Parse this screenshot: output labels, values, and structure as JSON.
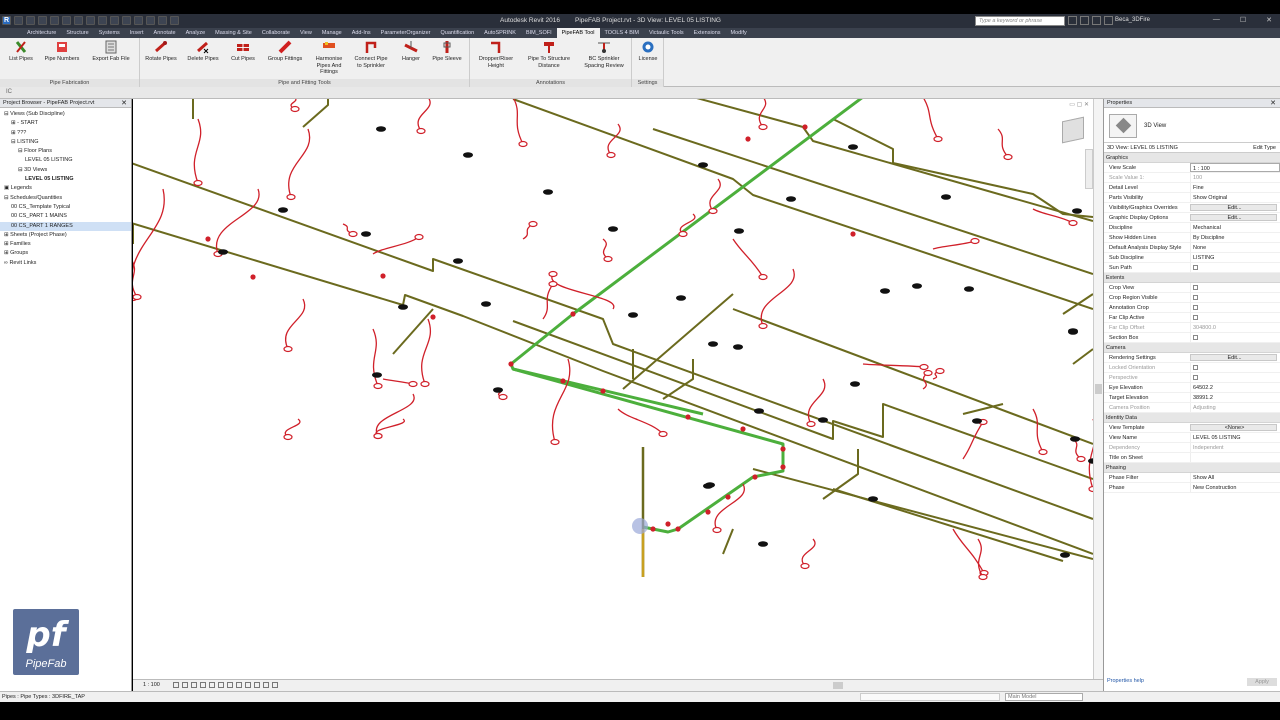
{
  "titlebar": {
    "app": "Autodesk Revit 2016",
    "document": "PipeFAB Project.rvt - 3D View: LEVEL 05 LISTING",
    "search_placeholder": "Type a keyword or phrase",
    "user": "Beca_3DFire"
  },
  "tabs": [
    "Architecture",
    "Structure",
    "Systems",
    "Insert",
    "Annotate",
    "Analyze",
    "Massing & Site",
    "Collaborate",
    "View",
    "Manage",
    "Add-Ins",
    "ParameterOrganizer",
    "Quantification",
    "AutoSPRINK",
    "BIM_SOFI",
    "PipeFAB Tool",
    "TOOLS 4 BIM",
    "Victaulic Tools",
    "Extensions",
    "Modify"
  ],
  "active_tab": "PipeFAB Tool",
  "ribbon": {
    "panels": {
      "pipe_fabrication": "Pipe Fabrication",
      "pipe_fitting_tools": "Pipe and Fitting Tools",
      "annotations": "Annotations",
      "settings": "Settings"
    },
    "buttons": {
      "list_pipes": "List Pipes",
      "pipe_numbers": "Pipe Numbers",
      "export_fab": "Export Fab File",
      "rotate_pipes": "Rotate Pipes",
      "delete_pipes": "Delete Pipes",
      "cut_pipes": "Cut Pipes",
      "group_fittings": "Group Fittings",
      "harmonise": "Harmonise Pipes And Fittings",
      "connect_pipe": "Connect Pipe to Sprinkler",
      "hanger": "Hanger",
      "pipe_sleeve": "Pipe Sleeve",
      "dropper_height": "Dropper/Riser Height",
      "pipe_to_structure": "Pipe To Structure Distance",
      "bc_sprinkler": "BC Sprinkler Spacing Review",
      "license": "License"
    }
  },
  "optionsbar": {
    "label": "IC"
  },
  "browser": {
    "title": "Project Browser - PipeFAB Project.rvt",
    "nodes": [
      {
        "text": "⊟ Views (Sub Discipline)",
        "indent": 0
      },
      {
        "text": "⊞ - START",
        "indent": 1
      },
      {
        "text": "⊞ ???",
        "indent": 1
      },
      {
        "text": "⊟ LISTING",
        "indent": 1
      },
      {
        "text": "⊟ Floor Plans",
        "indent": 2
      },
      {
        "text": "LEVEL 05 LISTING",
        "indent": 3
      },
      {
        "text": "⊟ 3D Views",
        "indent": 2
      },
      {
        "text": "LEVEL 05 LISTING",
        "indent": 3,
        "bold": true
      },
      {
        "text": "▣ Legends",
        "indent": 0
      },
      {
        "text": "⊟ Schedules/Quantities",
        "indent": 0
      },
      {
        "text": "00 CS_Template Typical",
        "indent": 1
      },
      {
        "text": "00 CS_PART 1 MAINS",
        "indent": 1
      },
      {
        "text": "00 CS_PART 1 RANGES",
        "indent": 1,
        "sel": true
      },
      {
        "text": "⊞ Sheets (Project Phase)",
        "indent": 0
      },
      {
        "text": "⊞ Families",
        "indent": 0
      },
      {
        "text": "⊞ Groups",
        "indent": 0
      },
      {
        "text": "∞ Revit Links",
        "indent": 0
      }
    ]
  },
  "logo": {
    "mark": "pf",
    "name": "PipeFab"
  },
  "viewbar": {
    "scale": "1 : 100"
  },
  "properties": {
    "title": "Properties",
    "type_name": "3D View",
    "instance": "3D View: LEVEL 05 LISTING",
    "edit_type": "Edit Type",
    "groups": [
      {
        "name": "Graphics",
        "rows": [
          {
            "k": "View Scale",
            "v": "1 : 100",
            "style": "box"
          },
          {
            "k": "Scale Value  1:",
            "v": "100",
            "dim": true
          },
          {
            "k": "Detail Level",
            "v": "Fine"
          },
          {
            "k": "Parts Visibility",
            "v": "Show Original"
          },
          {
            "k": "Visibility/Graphics Overrides",
            "v": "Edit...",
            "style": "btn"
          },
          {
            "k": "Graphic Display Options",
            "v": "Edit...",
            "style": "btn"
          },
          {
            "k": "Discipline",
            "v": "Mechanical"
          },
          {
            "k": "Show Hidden Lines",
            "v": "By Discipline"
          },
          {
            "k": "Default Analysis Display Style",
            "v": "None"
          },
          {
            "k": "Sub Discipline",
            "v": "LISTING"
          },
          {
            "k": "Sun Path",
            "v": "",
            "style": "chk"
          }
        ]
      },
      {
        "name": "Extents",
        "rows": [
          {
            "k": "Crop View",
            "v": "",
            "style": "chk"
          },
          {
            "k": "Crop Region Visible",
            "v": "",
            "style": "chk"
          },
          {
            "k": "Annotation Crop",
            "v": "",
            "style": "chk"
          },
          {
            "k": "Far Clip Active",
            "v": "",
            "style": "chk"
          },
          {
            "k": "Far Clip Offset",
            "v": "304800.0",
            "dim": true
          },
          {
            "k": "Section Box",
            "v": "",
            "style": "chk"
          }
        ]
      },
      {
        "name": "Camera",
        "rows": [
          {
            "k": "Rendering Settings",
            "v": "Edit...",
            "style": "btn"
          },
          {
            "k": "Locked Orientation",
            "v": "",
            "style": "chk",
            "dim": true
          },
          {
            "k": "Perspective",
            "v": "",
            "style": "chk",
            "dim": true
          },
          {
            "k": "Eye Elevation",
            "v": "64502.2"
          },
          {
            "k": "Target Elevation",
            "v": "38991.2"
          },
          {
            "k": "Camera Position",
            "v": "Adjusting",
            "dim": true
          }
        ]
      },
      {
        "name": "Identity Data",
        "rows": [
          {
            "k": "View Template",
            "v": "<None>",
            "style": "btn"
          },
          {
            "k": "View Name",
            "v": "LEVEL 05 LISTING"
          },
          {
            "k": "Dependency",
            "v": "Independent",
            "dim": true
          },
          {
            "k": "Title on Sheet",
            "v": ""
          }
        ]
      },
      {
        "name": "Phasing",
        "rows": [
          {
            "k": "Phase Filter",
            "v": "Show All"
          },
          {
            "k": "Phase",
            "v": "New Construction"
          }
        ]
      }
    ],
    "help": "Properties help",
    "apply": "Apply"
  },
  "status": {
    "text": "Pipes : Pipe Types : 3DFIRE_TAP",
    "model": "Main Model"
  },
  "colors": {
    "main_pipe": "#4caf3c",
    "branch_pipe": "#6b6a1e",
    "drop": "#d0202a",
    "head": "#111111",
    "riser": "#c8a020"
  }
}
